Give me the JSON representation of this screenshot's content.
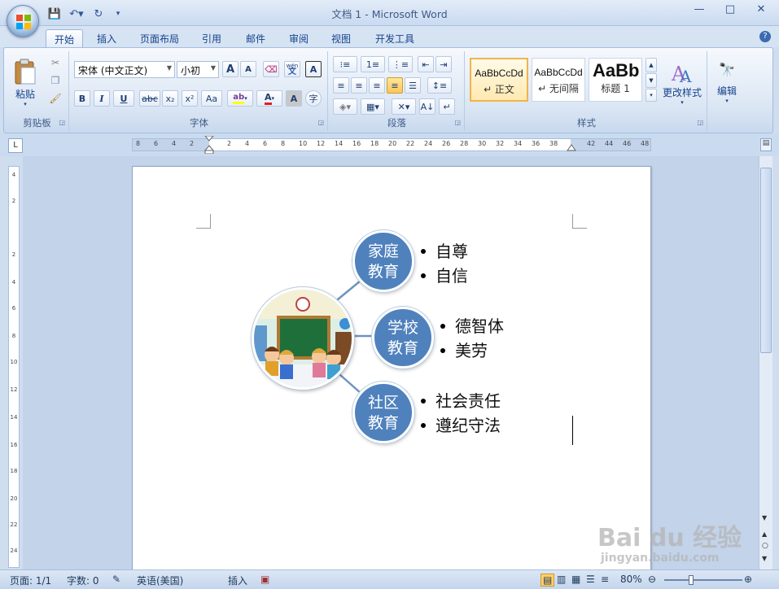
{
  "window": {
    "title": "文档 1 - Microsoft Word",
    "minimize": "—",
    "maximize": "□",
    "close": "✕"
  },
  "qat": {
    "save": "💾",
    "undo": "↶▾",
    "redo": "↻",
    "customize": "▾"
  },
  "tabs": [
    "开始",
    "插入",
    "页面布局",
    "引用",
    "邮件",
    "审阅",
    "视图",
    "开发工具"
  ],
  "ribbon": {
    "clipboard": {
      "label": "剪贴板",
      "paste": "粘贴"
    },
    "font": {
      "label": "字体",
      "font_name": "宋体 (中文正文)",
      "font_size": "小初",
      "grow": "A",
      "shrink": "A",
      "bold": "B",
      "italic": "I",
      "underline": "U",
      "strike": "abc",
      "subscript": "x₂",
      "superscript": "x²",
      "change_case": "Aa",
      "font_color": "A",
      "char_shading": "A",
      "enclose": "字",
      "phonetic": "wén",
      "phonetic_char": "文",
      "border_char": "A"
    },
    "paragraph": {
      "label": "段落"
    },
    "styles": {
      "label": "样式",
      "cards": [
        {
          "preview": "AaBbCcDd",
          "name": "↵ 正文"
        },
        {
          "preview": "AaBbCcDd",
          "name": "↵ 无间隔"
        },
        {
          "preview": "AaBb",
          "name": "标题 1"
        }
      ],
      "change_styles": "更改样式"
    },
    "editing": {
      "label": "编辑"
    }
  },
  "ruler": {
    "corner": "L",
    "h_numbers": [
      "8",
      "6",
      "4",
      "2",
      "2",
      "4",
      "6",
      "8",
      "10",
      "12",
      "14",
      "16",
      "18",
      "20",
      "22",
      "24",
      "26",
      "28",
      "30",
      "32",
      "34",
      "36",
      "38",
      "42",
      "44",
      "46",
      "48"
    ],
    "v_numbers": [
      "4",
      "2",
      "2",
      "4",
      "6",
      "8",
      "10",
      "12",
      "14",
      "16",
      "18",
      "20",
      "22",
      "24"
    ]
  },
  "document": {
    "nodes": [
      {
        "label_line1": "家庭",
        "label_line2": "教育",
        "bullets": [
          "自尊",
          "自信"
        ]
      },
      {
        "label_line1": "学校",
        "label_line2": "教育",
        "bullets": [
          "德智体",
          "美劳"
        ]
      },
      {
        "label_line1": "社区",
        "label_line2": "教育",
        "bullets": [
          "社会责任",
          "遵纪守法"
        ]
      }
    ]
  },
  "status": {
    "page": "页面: 1/1",
    "words": "字数: 0",
    "language": "英语(美国)",
    "mode": "插入",
    "zoom": "80%"
  },
  "watermark": {
    "brand": "Bai du 经验",
    "url": "jingyan.baidu.com"
  }
}
